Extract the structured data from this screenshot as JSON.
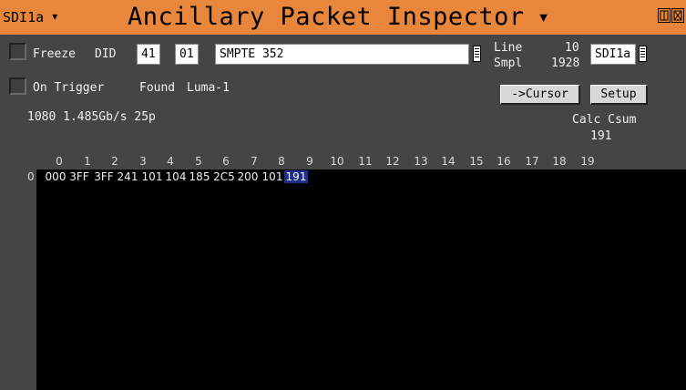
{
  "titlebar": {
    "source_label": "SDI1a",
    "title": "Ancillary Packet Inspector"
  },
  "controls": {
    "freeze_label": "Freeze",
    "did_label": "DID",
    "did_value": "41",
    "sdid_value": "01",
    "standard_value": "SMPTE 352",
    "line_label": "Line",
    "line_value": "10",
    "smpl_label": "Smpl",
    "smpl_value": "1928",
    "input_value": "SDI1a",
    "on_trigger_label": "On Trigger",
    "found_label": "Found",
    "found_value": "Luma-1",
    "cursor_button": "->Cursor",
    "setup_button": "Setup",
    "format_text": "1080 1.485Gb/s 25p",
    "calc_csum_label": "Calc Csum",
    "calc_csum_value": "191"
  },
  "grid": {
    "columns": [
      "0",
      "1",
      "2",
      "3",
      "4",
      "5",
      "6",
      "7",
      "8",
      "9",
      "10",
      "11",
      "12",
      "13",
      "14",
      "15",
      "16",
      "17",
      "18",
      "19"
    ],
    "row_label": "0",
    "cells": [
      "000",
      "3FF",
      "3FF",
      "241",
      "101",
      "104",
      "185",
      "2C5",
      "200",
      "101",
      "191"
    ],
    "selected_index": 10
  },
  "colors": {
    "titlebar": "#e8863c",
    "background": "#454545",
    "selected": "#1f2f8e"
  }
}
